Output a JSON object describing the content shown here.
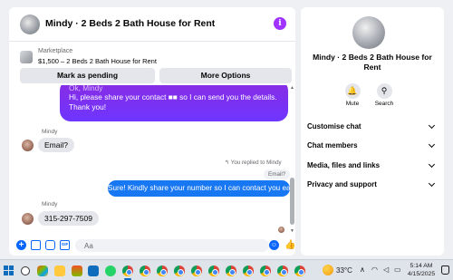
{
  "chat": {
    "title": "Mindy · 2 Beds 2 Bath House for Rent",
    "info_glyph": "i",
    "marketplace": {
      "label": "Marketplace",
      "listing": "$1,500 – 2 Beds 2 Bath House for Rent"
    },
    "buttons": {
      "mark_pending": "Mark as pending",
      "more_options": "More Options"
    },
    "messages": {
      "outgoing_cut": "Ok, Mindy",
      "outgoing_purple": "Hi, please share your contact ■■ so I can send you the details. Thank you!",
      "sender_1": "Mindy",
      "incoming_1": "Email?",
      "replied_note": "↰ You replied to Mindy",
      "quoted": "Email?",
      "outgoing_blue": "Sure! Kindly share your number so I can contact you easily.",
      "sender_2": "Mindy",
      "incoming_2": "315-297-7509"
    },
    "composer": {
      "placeholder": "Aa",
      "plus_glyph": "+",
      "gif_glyph": "GIF",
      "emoji_glyph": "☺",
      "like_glyph": "👍"
    }
  },
  "info_panel": {
    "name": "Mindy · 2 Beds 2 Bath House for Rent",
    "actions": {
      "mute": "Mute",
      "search": "Search",
      "mute_glyph": "🔔",
      "search_glyph": "⚲"
    },
    "sections": [
      "Customise chat",
      "Chat members",
      "Media, files and links",
      "Privacy and support"
    ]
  },
  "taskbar": {
    "temperature": "33°C",
    "time": "5:14 AM",
    "date": "4/15/2025",
    "tray_chevron": "∧",
    "icons": [
      "start-icon",
      "search-icon",
      "copilot-icon",
      "file-explorer-icon",
      "store-icon",
      "outlook-icon",
      "whatsapp-icon",
      "chrome-icon",
      "chrome-icon",
      "chrome-icon",
      "chrome-icon",
      "chrome-icon",
      "chrome-icon",
      "chrome-icon",
      "chrome-icon",
      "chrome-icon",
      "chrome-icon",
      "chrome-icon"
    ]
  },
  "colors": {
    "accent_blue": "#1877f2",
    "purple": "#7b2ff7",
    "info_purple": "#a033ff",
    "background": "#eef0f3"
  }
}
